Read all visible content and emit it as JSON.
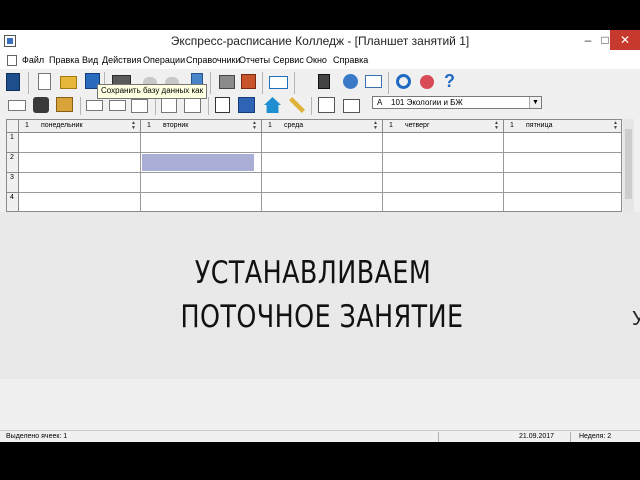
{
  "window": {
    "title": "Экспресс-расписание Колледж - [Планшет занятий 1]",
    "min_label": "–",
    "max_label": "□",
    "close_label": "✕"
  },
  "menu": [
    "Файл",
    "Правка",
    "Вид",
    "Действия",
    "Операции",
    "Справочники",
    "Отчеты",
    "Сервис",
    "Окно",
    "Справка"
  ],
  "tooltip": "Сохранить базу данных как",
  "group_selector": {
    "prefix": "А",
    "value": "101  Экологии и БЖ"
  },
  "grid": {
    "columns": [
      {
        "num": "1",
        "day": "понедельник"
      },
      {
        "num": "1",
        "day": "вторник"
      },
      {
        "num": "1",
        "day": "среда"
      },
      {
        "num": "1",
        "day": "четверг"
      },
      {
        "num": "1",
        "day": "пятница"
      }
    ],
    "rows": [
      "1",
      "2",
      "3",
      "4"
    ],
    "selected": {
      "row": 2,
      "column": "вторник"
    }
  },
  "banner": {
    "line1": "УСТАНАВЛИВАЕМ",
    "line2": "ПОТОЧНОЕ ЗАНЯТИЕ",
    "edge_glyph": "У"
  },
  "status": {
    "selected": "Выделено ячеек: 1",
    "date": "21.09.2017",
    "week": "Неделя: 2"
  },
  "colors": {
    "selection": "#a9aed6",
    "close_button": "#c7392c",
    "banner": "#e9e9e9"
  }
}
